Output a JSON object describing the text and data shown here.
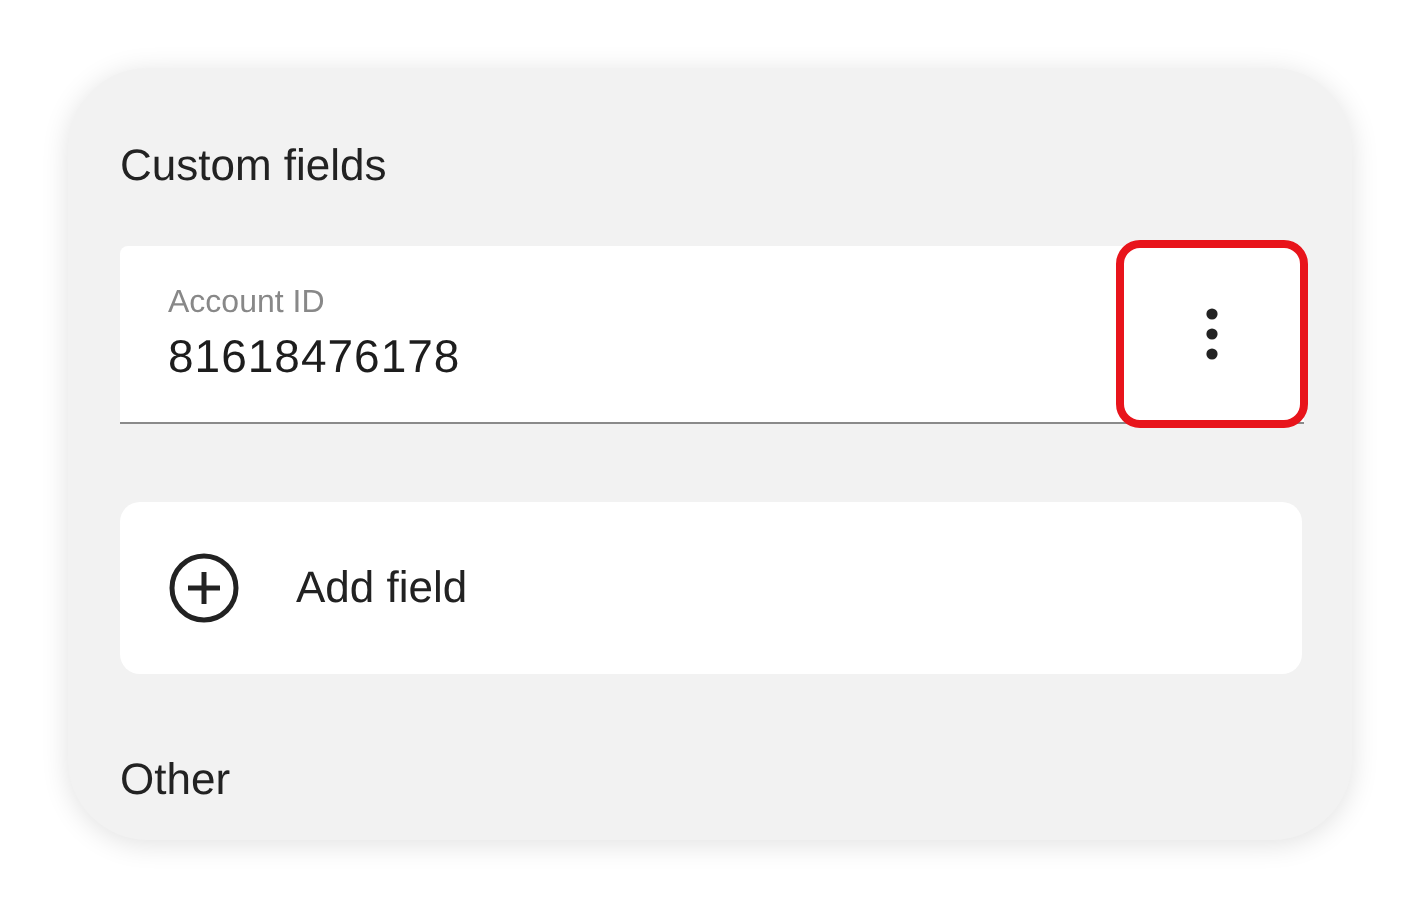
{
  "sections": [
    {
      "title": "Custom fields"
    },
    {
      "title": "Other"
    }
  ],
  "custom_field": {
    "label": "Account ID",
    "value": "81618476178",
    "menu_highlighted": true
  },
  "add_button": {
    "label": "Add field"
  }
}
